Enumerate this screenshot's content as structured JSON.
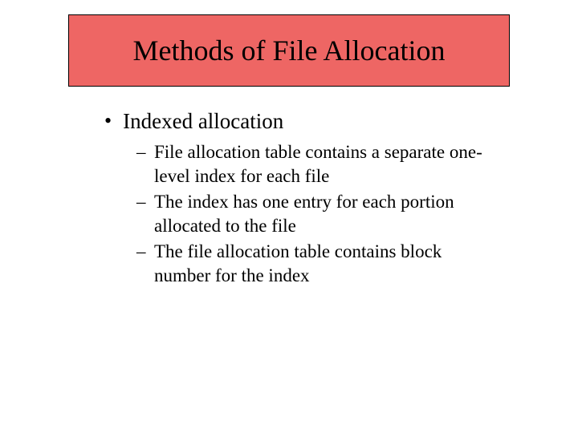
{
  "title": "Methods of File Allocation",
  "bullet": {
    "marker": "•",
    "text": "Indexed allocation"
  },
  "subitems": [
    {
      "dash": "–",
      "text": "File allocation table contains a separate one-level index for each file"
    },
    {
      "dash": "–",
      "text": "The index has one entry for each portion allocated to the file"
    },
    {
      "dash": "–",
      "text": "The file allocation table contains block number for the index"
    }
  ]
}
